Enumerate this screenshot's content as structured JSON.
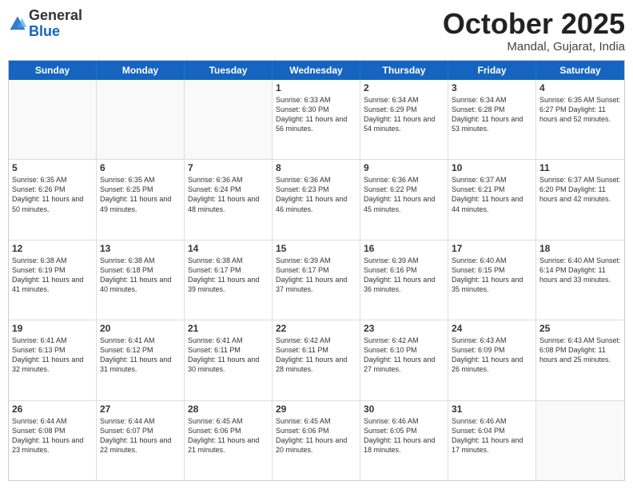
{
  "header": {
    "logo_general": "General",
    "logo_blue": "Blue",
    "month_title": "October 2025",
    "subtitle": "Mandal, Gujarat, India"
  },
  "days_of_week": [
    "Sunday",
    "Monday",
    "Tuesday",
    "Wednesday",
    "Thursday",
    "Friday",
    "Saturday"
  ],
  "weeks": [
    [
      {
        "day": "",
        "info": ""
      },
      {
        "day": "",
        "info": ""
      },
      {
        "day": "",
        "info": ""
      },
      {
        "day": "1",
        "info": "Sunrise: 6:33 AM\nSunset: 6:30 PM\nDaylight: 11 hours and 56 minutes."
      },
      {
        "day": "2",
        "info": "Sunrise: 6:34 AM\nSunset: 6:29 PM\nDaylight: 11 hours and 54 minutes."
      },
      {
        "day": "3",
        "info": "Sunrise: 6:34 AM\nSunset: 6:28 PM\nDaylight: 11 hours and 53 minutes."
      },
      {
        "day": "4",
        "info": "Sunrise: 6:35 AM\nSunset: 6:27 PM\nDaylight: 11 hours and 52 minutes."
      }
    ],
    [
      {
        "day": "5",
        "info": "Sunrise: 6:35 AM\nSunset: 6:26 PM\nDaylight: 11 hours and 50 minutes."
      },
      {
        "day": "6",
        "info": "Sunrise: 6:35 AM\nSunset: 6:25 PM\nDaylight: 11 hours and 49 minutes."
      },
      {
        "day": "7",
        "info": "Sunrise: 6:36 AM\nSunset: 6:24 PM\nDaylight: 11 hours and 48 minutes."
      },
      {
        "day": "8",
        "info": "Sunrise: 6:36 AM\nSunset: 6:23 PM\nDaylight: 11 hours and 46 minutes."
      },
      {
        "day": "9",
        "info": "Sunrise: 6:36 AM\nSunset: 6:22 PM\nDaylight: 11 hours and 45 minutes."
      },
      {
        "day": "10",
        "info": "Sunrise: 6:37 AM\nSunset: 6:21 PM\nDaylight: 11 hours and 44 minutes."
      },
      {
        "day": "11",
        "info": "Sunrise: 6:37 AM\nSunset: 6:20 PM\nDaylight: 11 hours and 42 minutes."
      }
    ],
    [
      {
        "day": "12",
        "info": "Sunrise: 6:38 AM\nSunset: 6:19 PM\nDaylight: 11 hours and 41 minutes."
      },
      {
        "day": "13",
        "info": "Sunrise: 6:38 AM\nSunset: 6:18 PM\nDaylight: 11 hours and 40 minutes."
      },
      {
        "day": "14",
        "info": "Sunrise: 6:38 AM\nSunset: 6:17 PM\nDaylight: 11 hours and 39 minutes."
      },
      {
        "day": "15",
        "info": "Sunrise: 6:39 AM\nSunset: 6:17 PM\nDaylight: 11 hours and 37 minutes."
      },
      {
        "day": "16",
        "info": "Sunrise: 6:39 AM\nSunset: 6:16 PM\nDaylight: 11 hours and 36 minutes."
      },
      {
        "day": "17",
        "info": "Sunrise: 6:40 AM\nSunset: 6:15 PM\nDaylight: 11 hours and 35 minutes."
      },
      {
        "day": "18",
        "info": "Sunrise: 6:40 AM\nSunset: 6:14 PM\nDaylight: 11 hours and 33 minutes."
      }
    ],
    [
      {
        "day": "19",
        "info": "Sunrise: 6:41 AM\nSunset: 6:13 PM\nDaylight: 11 hours and 32 minutes."
      },
      {
        "day": "20",
        "info": "Sunrise: 6:41 AM\nSunset: 6:12 PM\nDaylight: 11 hours and 31 minutes."
      },
      {
        "day": "21",
        "info": "Sunrise: 6:41 AM\nSunset: 6:11 PM\nDaylight: 11 hours and 30 minutes."
      },
      {
        "day": "22",
        "info": "Sunrise: 6:42 AM\nSunset: 6:11 PM\nDaylight: 11 hours and 28 minutes."
      },
      {
        "day": "23",
        "info": "Sunrise: 6:42 AM\nSunset: 6:10 PM\nDaylight: 11 hours and 27 minutes."
      },
      {
        "day": "24",
        "info": "Sunrise: 6:43 AM\nSunset: 6:09 PM\nDaylight: 11 hours and 26 minutes."
      },
      {
        "day": "25",
        "info": "Sunrise: 6:43 AM\nSunset: 6:08 PM\nDaylight: 11 hours and 25 minutes."
      }
    ],
    [
      {
        "day": "26",
        "info": "Sunrise: 6:44 AM\nSunset: 6:08 PM\nDaylight: 11 hours and 23 minutes."
      },
      {
        "day": "27",
        "info": "Sunrise: 6:44 AM\nSunset: 6:07 PM\nDaylight: 11 hours and 22 minutes."
      },
      {
        "day": "28",
        "info": "Sunrise: 6:45 AM\nSunset: 6:06 PM\nDaylight: 11 hours and 21 minutes."
      },
      {
        "day": "29",
        "info": "Sunrise: 6:45 AM\nSunset: 6:06 PM\nDaylight: 11 hours and 20 minutes."
      },
      {
        "day": "30",
        "info": "Sunrise: 6:46 AM\nSunset: 6:05 PM\nDaylight: 11 hours and 18 minutes."
      },
      {
        "day": "31",
        "info": "Sunrise: 6:46 AM\nSunset: 6:04 PM\nDaylight: 11 hours and 17 minutes."
      },
      {
        "day": "",
        "info": ""
      }
    ]
  ]
}
